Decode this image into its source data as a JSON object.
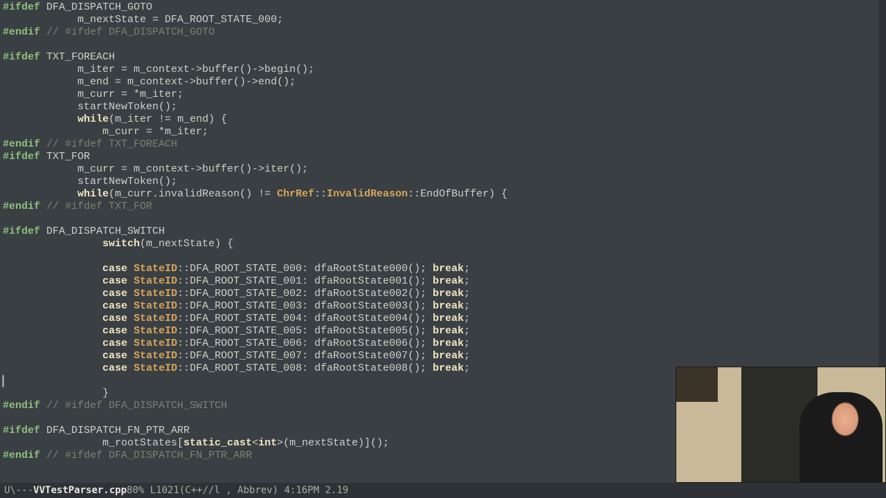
{
  "code_lines": [
    [
      [
        "preproc",
        "#ifdef"
      ],
      [
        "ident",
        " DFA_DISPATCH_GOTO"
      ]
    ],
    [
      [
        "ident",
        "            m_nextState = DFA_ROOT_STATE_000;"
      ]
    ],
    [
      [
        "preproc",
        "#endif"
      ],
      [
        "ident",
        " "
      ],
      [
        "comment",
        "// #ifdef DFA_DISPATCH_GOTO"
      ]
    ],
    [],
    [
      [
        "preproc",
        "#ifdef"
      ],
      [
        "ident",
        " TXT_FOREACH"
      ]
    ],
    [
      [
        "ident",
        "            m_iter = m_context->buffer()->begin();"
      ]
    ],
    [
      [
        "ident",
        "            m_end = m_context->buffer()->end();"
      ]
    ],
    [
      [
        "ident",
        "            m_curr = *m_iter;"
      ]
    ],
    [
      [
        "ident",
        "            startNewToken();"
      ]
    ],
    [
      [
        "ident",
        "            "
      ],
      [
        "keyword",
        "while"
      ],
      [
        "ident",
        "(m_iter != m_end) {"
      ]
    ],
    [
      [
        "ident",
        "                m_curr = *m_iter;"
      ]
    ],
    [
      [
        "preproc",
        "#endif"
      ],
      [
        "ident",
        " "
      ],
      [
        "comment",
        "// #ifdef TXT_FOREACH"
      ]
    ],
    [
      [
        "preproc",
        "#ifdef"
      ],
      [
        "ident",
        " TXT_FOR"
      ]
    ],
    [
      [
        "ident",
        "            m_curr = m_context->buffer()->iter();"
      ]
    ],
    [
      [
        "ident",
        "            startNewToken();"
      ]
    ],
    [
      [
        "ident",
        "            "
      ],
      [
        "keyword",
        "while"
      ],
      [
        "ident",
        "(m_curr.invalidReason() != "
      ],
      [
        "type",
        "ChrRef"
      ],
      [
        "ident",
        "::"
      ],
      [
        "type",
        "InvalidReason"
      ],
      [
        "ident",
        "::EndOfBuffer) {"
      ]
    ],
    [
      [
        "preproc",
        "#endif"
      ],
      [
        "ident",
        " "
      ],
      [
        "comment",
        "// #ifdef TXT_FOR"
      ]
    ],
    [],
    [
      [
        "preproc",
        "#ifdef"
      ],
      [
        "ident",
        " DFA_DISPATCH_SWITCH"
      ]
    ],
    [
      [
        "ident",
        "                "
      ],
      [
        "keyword",
        "switch"
      ],
      [
        "ident",
        "(m_nextState) {"
      ]
    ],
    [],
    [
      [
        "ident",
        "                "
      ],
      [
        "keyword",
        "case"
      ],
      [
        "ident",
        " "
      ],
      [
        "type",
        "StateID"
      ],
      [
        "ident",
        "::DFA_ROOT_STATE_000: dfaRootState000(); "
      ],
      [
        "keyword",
        "break"
      ],
      [
        "ident",
        ";"
      ]
    ],
    [
      [
        "ident",
        "                "
      ],
      [
        "keyword",
        "case"
      ],
      [
        "ident",
        " "
      ],
      [
        "type",
        "StateID"
      ],
      [
        "ident",
        "::DFA_ROOT_STATE_001: dfaRootState001(); "
      ],
      [
        "keyword",
        "break"
      ],
      [
        "ident",
        ";"
      ]
    ],
    [
      [
        "ident",
        "                "
      ],
      [
        "keyword",
        "case"
      ],
      [
        "ident",
        " "
      ],
      [
        "type",
        "StateID"
      ],
      [
        "ident",
        "::DFA_ROOT_STATE_002: dfaRootState002(); "
      ],
      [
        "keyword",
        "break"
      ],
      [
        "ident",
        ";"
      ]
    ],
    [
      [
        "ident",
        "                "
      ],
      [
        "keyword",
        "case"
      ],
      [
        "ident",
        " "
      ],
      [
        "type",
        "StateID"
      ],
      [
        "ident",
        "::DFA_ROOT_STATE_003: dfaRootState003(); "
      ],
      [
        "keyword",
        "break"
      ],
      [
        "ident",
        ";"
      ]
    ],
    [
      [
        "ident",
        "                "
      ],
      [
        "keyword",
        "case"
      ],
      [
        "ident",
        " "
      ],
      [
        "type",
        "StateID"
      ],
      [
        "ident",
        "::DFA_ROOT_STATE_004: dfaRootState004(); "
      ],
      [
        "keyword",
        "break"
      ],
      [
        "ident",
        ";"
      ]
    ],
    [
      [
        "ident",
        "                "
      ],
      [
        "keyword",
        "case"
      ],
      [
        "ident",
        " "
      ],
      [
        "type",
        "StateID"
      ],
      [
        "ident",
        "::DFA_ROOT_STATE_005: dfaRootState005(); "
      ],
      [
        "keyword",
        "break"
      ],
      [
        "ident",
        ";"
      ]
    ],
    [
      [
        "ident",
        "                "
      ],
      [
        "keyword",
        "case"
      ],
      [
        "ident",
        " "
      ],
      [
        "type",
        "StateID"
      ],
      [
        "ident",
        "::DFA_ROOT_STATE_006: dfaRootState006(); "
      ],
      [
        "keyword",
        "break"
      ],
      [
        "ident",
        ";"
      ]
    ],
    [
      [
        "ident",
        "                "
      ],
      [
        "keyword",
        "case"
      ],
      [
        "ident",
        " "
      ],
      [
        "type",
        "StateID"
      ],
      [
        "ident",
        "::DFA_ROOT_STATE_007: dfaRootState007(); "
      ],
      [
        "keyword",
        "break"
      ],
      [
        "ident",
        ";"
      ]
    ],
    [
      [
        "ident",
        "                "
      ],
      [
        "keyword",
        "case"
      ],
      [
        "ident",
        " "
      ],
      [
        "type",
        "StateID"
      ],
      [
        "ident",
        "::DFA_ROOT_STATE_008: dfaRootState008(); "
      ],
      [
        "keyword",
        "break"
      ],
      [
        "ident",
        ";"
      ]
    ],
    [
      [
        "cursor",
        ""
      ]
    ],
    [
      [
        "ident",
        "                }"
      ]
    ],
    [
      [
        "preproc",
        "#endif"
      ],
      [
        "ident",
        " "
      ],
      [
        "comment",
        "// #ifdef DFA_DISPATCH_SWITCH"
      ]
    ],
    [],
    [
      [
        "preproc",
        "#ifdef"
      ],
      [
        "ident",
        " DFA_DISPATCH_FN_PTR_ARR"
      ]
    ],
    [
      [
        "ident",
        "                m_rootStates["
      ],
      [
        "keyword",
        "static_cast"
      ],
      [
        "ident",
        "<"
      ],
      [
        "keyword",
        "int"
      ],
      [
        "ident",
        ">(m_nextState)]();"
      ]
    ],
    [
      [
        "preproc",
        "#endif"
      ],
      [
        "ident",
        " "
      ],
      [
        "comment",
        "// #ifdef DFA_DISPATCH_FN_PTR_ARR"
      ]
    ]
  ],
  "status": {
    "prefix": " U\\---",
    "filename": "VVTestParser.cpp",
    "position": "   80% L1021",
    "mode": "  (C++//l , Abbrev) 4:16PM 2.19"
  }
}
